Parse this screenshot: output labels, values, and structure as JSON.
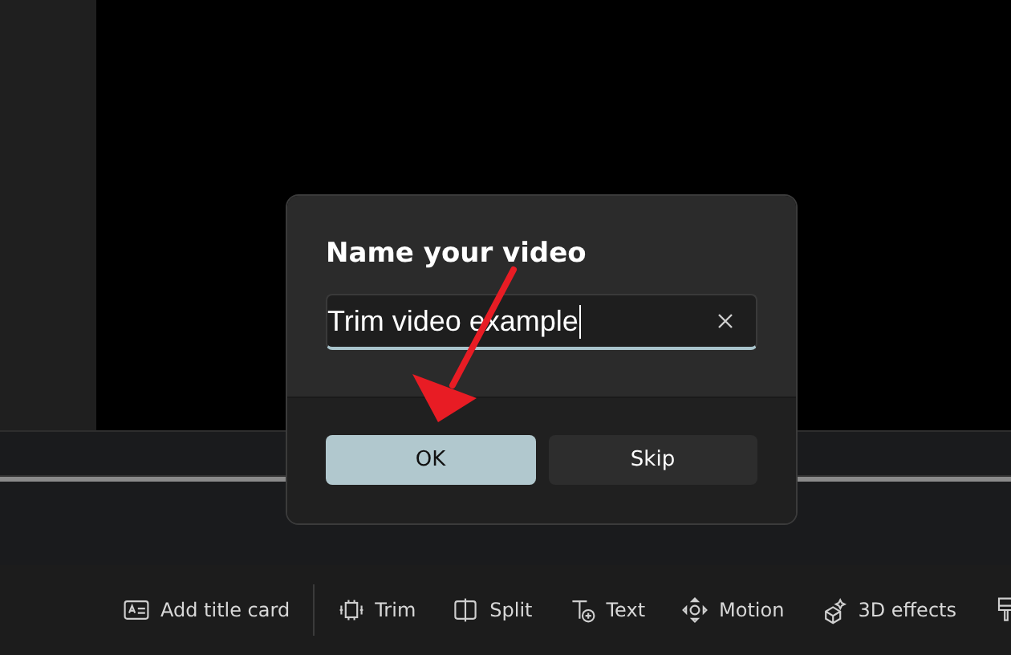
{
  "dialog": {
    "title": "Name your video",
    "field": {
      "value": "Trim video example",
      "focused": true
    },
    "buttons": [
      {
        "label": "OK",
        "kind": "primary"
      },
      {
        "label": "Skip",
        "kind": "secondary"
      }
    ]
  },
  "toolbar": {
    "items": [
      {
        "label": "Add title card",
        "kind": "card"
      },
      {
        "label": "Trim",
        "kind": "trim"
      },
      {
        "label": "Split",
        "kind": "split"
      },
      {
        "label": "Text",
        "kind": "text"
      },
      {
        "label": "Motion",
        "kind": "motion"
      },
      {
        "label": "3D effects",
        "kind": "effects"
      },
      {
        "kind": "brush"
      }
    ]
  }
}
